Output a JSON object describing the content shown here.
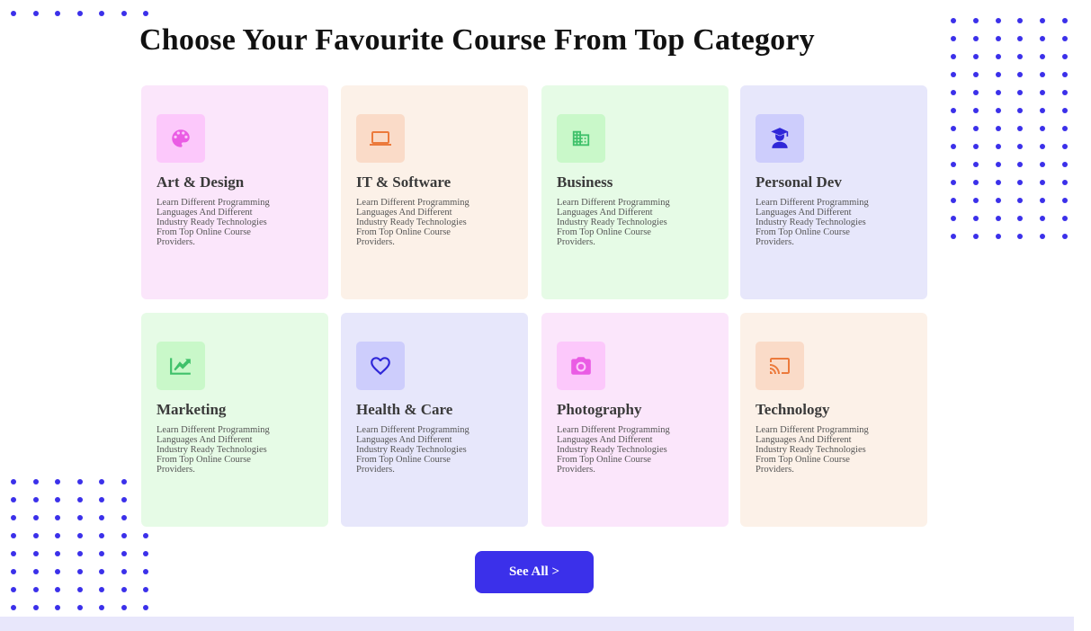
{
  "heading": "Choose Your Favourite Course From Top Category",
  "accent_color": "#3b30ea",
  "categories": [
    {
      "title": "Art & Design",
      "icon": "palette-icon",
      "desc": "Learn Different Programming Languages And Different Industry Ready Technologies From Top Online Course Providers.",
      "bg": "#fbe6fb",
      "icon_bg": "#fcc8fb",
      "icon_color": "#ea5ce4"
    },
    {
      "title": "IT & Software",
      "icon": "laptop-icon",
      "desc": "Learn Different Programming Languages And Different Industry Ready Technologies From Top Online Course Providers.",
      "bg": "#fcf1e8",
      "icon_bg": "#fadbc8",
      "icon_color": "#ec7a3c"
    },
    {
      "title": "Business",
      "icon": "building-icon",
      "desc": "Learn Different Programming Languages And Different Industry Ready Technologies From Top Online Course Providers.",
      "bg": "#e6fbe6",
      "icon_bg": "#c9f8c9",
      "icon_color": "#3fc16a"
    },
    {
      "title": "Personal Dev",
      "icon": "graduate-icon",
      "desc": "Learn Different Programming Languages And Different Industry Ready Technologies From Top Online Course Providers.",
      "bg": "#e7e7fb",
      "icon_bg": "#cdcdfc",
      "icon_color": "#2f27d8"
    },
    {
      "title": "Marketing",
      "icon": "trending-up-icon",
      "desc": "Learn Different Programming Languages And Different Industry Ready Technologies From Top Online Course Providers.",
      "bg": "#e6fbe6",
      "icon_bg": "#c9f8c9",
      "icon_color": "#3fc16a"
    },
    {
      "title": "Health & Care",
      "icon": "heart-icon",
      "desc": "Learn Different Programming Languages And Different Industry Ready Technologies From Top Online Course Providers.",
      "bg": "#e7e7fb",
      "icon_bg": "#cdcdfc",
      "icon_color": "#2f27d8"
    },
    {
      "title": "Photography",
      "icon": "camera-icon",
      "desc": "Learn Different Programming Languages And Different Industry Ready Technologies From Top Online Course Providers.",
      "bg": "#fbe6fb",
      "icon_bg": "#fcc8fb",
      "icon_color": "#ea5ce4"
    },
    {
      "title": "Technology",
      "icon": "cast-icon",
      "desc": "Learn Different Programming Languages And Different Industry Ready Technologies From Top Online Course Providers.",
      "bg": "#fcf1e8",
      "icon_bg": "#fadbc8",
      "icon_color": "#ec7a3c"
    }
  ],
  "see_all_label": "See All >"
}
